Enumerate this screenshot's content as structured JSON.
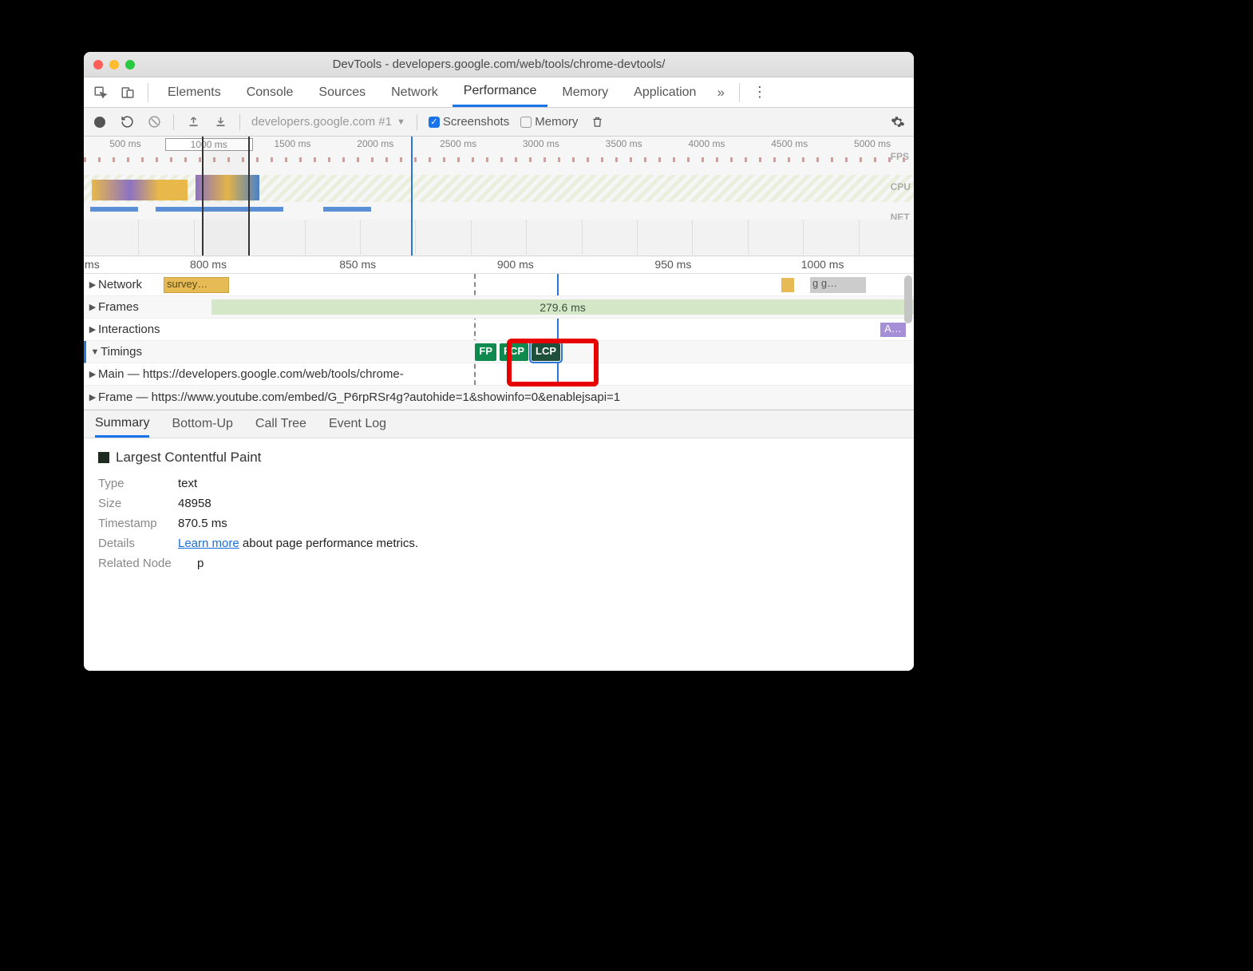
{
  "titlebar": {
    "title": "DevTools - developers.google.com/web/tools/chrome-devtools/"
  },
  "tabs": {
    "items": [
      "Elements",
      "Console",
      "Sources",
      "Network",
      "Performance",
      "Memory",
      "Application"
    ],
    "active_index": 4
  },
  "toolbar": {
    "recording_select": "developers.google.com #1",
    "screenshots_label": "Screenshots",
    "screenshots_checked": true,
    "memory_label": "Memory",
    "memory_checked": false
  },
  "overview": {
    "ticks": [
      "500 ms",
      "1000 ms",
      "1500 ms",
      "2000 ms",
      "2500 ms",
      "3000 ms",
      "3500 ms",
      "4000 ms",
      "4500 ms",
      "5000 ms"
    ],
    "lane_labels": [
      "FPS",
      "CPU",
      "NET"
    ]
  },
  "ruler": {
    "ticks": [
      "ms",
      "800 ms",
      "850 ms",
      "900 ms",
      "950 ms",
      "1000 ms"
    ]
  },
  "tracks": {
    "network": {
      "label": "Network",
      "item": "survey…"
    },
    "frames": {
      "label": "Frames",
      "duration": "279.6 ms"
    },
    "interactions": {
      "label": "Interactions",
      "item": "A…"
    },
    "timings": {
      "label": "Timings",
      "markers": [
        "FP",
        "FCP",
        "LCP"
      ]
    },
    "main": {
      "label": "Main — https://developers.google.com/web/tools/chrome-"
    },
    "frame": {
      "label": "Frame — https://www.youtube.com/embed/G_P6rpRSr4g?autohide=1&showinfo=0&enablejsapi=1"
    },
    "gg_item": "g g…"
  },
  "bottom_tabs": {
    "items": [
      "Summary",
      "Bottom-Up",
      "Call Tree",
      "Event Log"
    ],
    "active_index": 0
  },
  "summary": {
    "title": "Largest Contentful Paint",
    "type_label": "Type",
    "type_value": "text",
    "size_label": "Size",
    "size_value": "48958",
    "timestamp_label": "Timestamp",
    "timestamp_value": "870.5 ms",
    "details_label": "Details",
    "learn_more": "Learn more",
    "details_rest": " about page performance metrics.",
    "related_label": "Related Node",
    "related_value": "p"
  }
}
